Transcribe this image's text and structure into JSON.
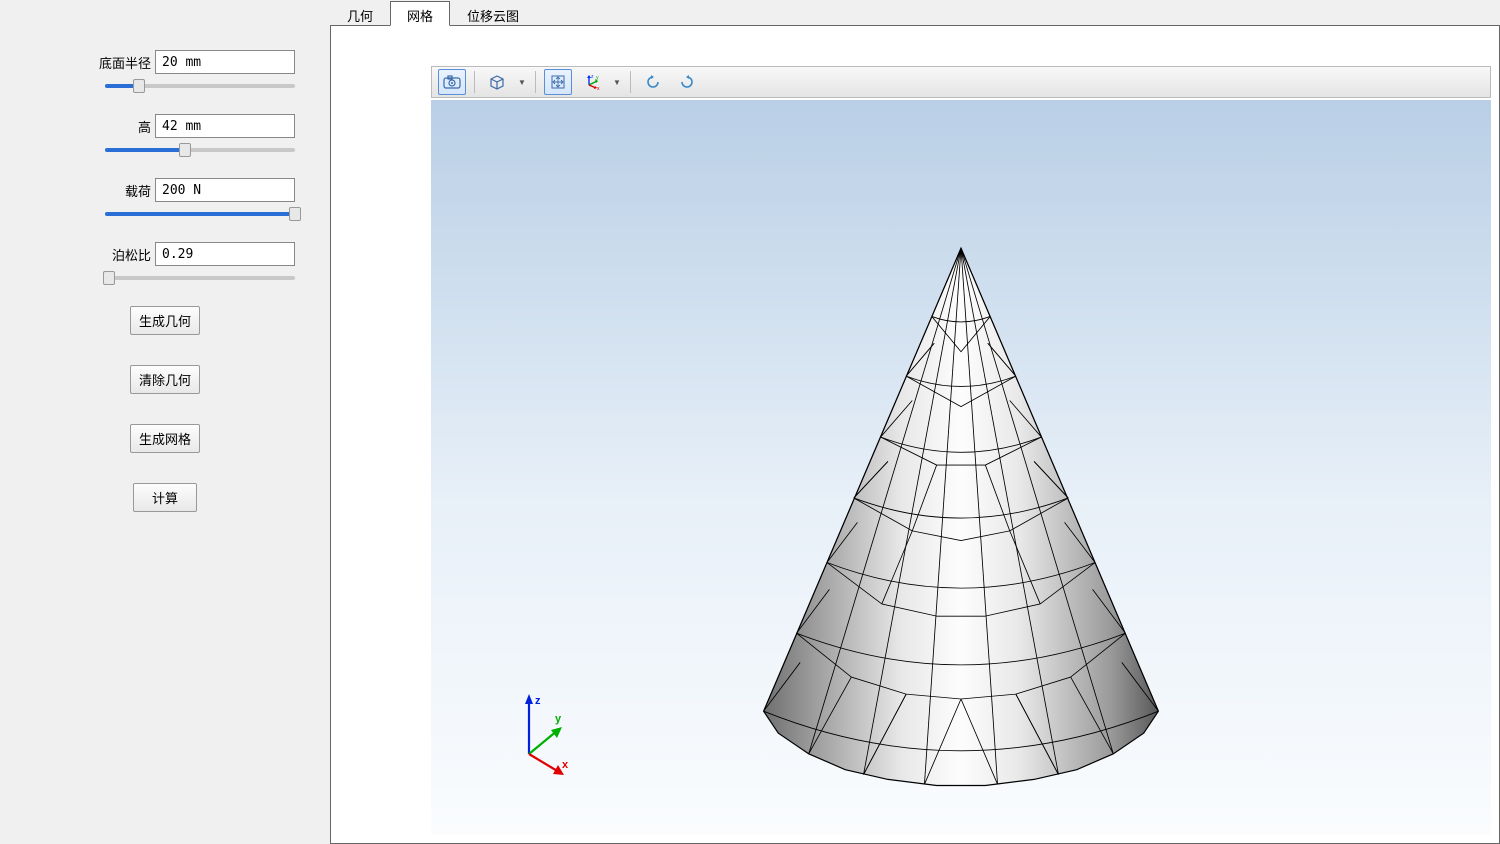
{
  "sidebar": {
    "params": [
      {
        "label": "底面半径",
        "value": "20 mm",
        "sliderPct": 18
      },
      {
        "label": "高",
        "value": "42 mm",
        "sliderPct": 42
      },
      {
        "label": "载荷",
        "value": "200 N",
        "sliderPct": 100
      },
      {
        "label": "泊松比",
        "value": "0.29",
        "sliderPct": 2
      }
    ],
    "buttons": {
      "generateGeometry": "生成几何",
      "clearGeometry": "清除几何",
      "generateMesh": "生成网格",
      "compute": "计算"
    }
  },
  "tabs": [
    {
      "label": "几何",
      "active": false
    },
    {
      "label": "网格",
      "active": true
    },
    {
      "label": "位移云图",
      "active": false
    }
  ],
  "axes": {
    "x": "x",
    "y": "y",
    "z": "z"
  }
}
